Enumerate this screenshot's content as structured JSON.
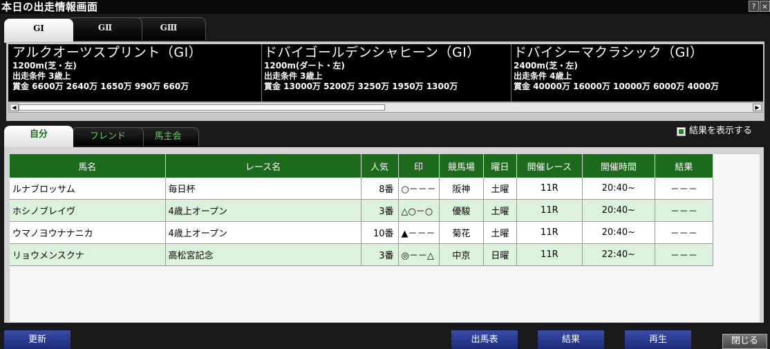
{
  "window": {
    "title": "本日の出走情報画面",
    "help_label": "?",
    "close_label": "×"
  },
  "grade_tabs": [
    {
      "label": "GⅠ",
      "active": true
    },
    {
      "label": "GⅡ",
      "active": false
    },
    {
      "label": "GⅢ",
      "active": false
    }
  ],
  "races": [
    {
      "name": "アルクオーツスプリント（GⅠ）",
      "distance": "1200m(芝・左)",
      "condition": "出走条件 3歳上",
      "prize": "賞金  6600万 2640万 1650万 990万 660万"
    },
    {
      "name": "ドバイゴールデンシャヒーン（GⅠ）",
      "distance": "1200m(ダート・左)",
      "condition": "出走条件 3歳上",
      "prize": "賞金  13000万 5200万 3250万 1950万 1300万"
    },
    {
      "name": "ドバイシーマクラシック（GⅠ）",
      "distance": "2400m(芝・左)",
      "condition": "出走条件 4歳上",
      "prize": "賞金  40000万 16000万 10000万 6000万 4000万"
    }
  ],
  "scroll": {
    "left_arrow": "◀",
    "right_arrow": "▶"
  },
  "friend_tabs": [
    {
      "label": "自分",
      "active": true
    },
    {
      "label": "フレンド",
      "active": false
    },
    {
      "label": "馬主会",
      "active": false
    }
  ],
  "show_results": {
    "label": "結果を表示する",
    "checked": true
  },
  "table": {
    "headers": [
      "馬名",
      "レース名",
      "人気",
      "印",
      "競馬場",
      "曜日",
      "開催レース",
      "開催時間",
      "結果"
    ],
    "rows": [
      [
        "ルナブロッサム",
        "毎日杯",
        "8番",
        "○－－－",
        "阪神",
        "土曜",
        "11R",
        "20:40~",
        "－－－"
      ],
      [
        "ホシノブレイヴ",
        "4歳上オープン",
        "3番",
        "△○－○",
        "優駿",
        "土曜",
        "11R",
        "20:40~",
        "－－－"
      ],
      [
        "ウマノヨウナナニカ",
        "4歳上オープン",
        "10番",
        "▲－－－",
        "菊花",
        "土曜",
        "11R",
        "20:40~",
        "－－－"
      ],
      [
        "リョウメンスクナ",
        "高松宮記念",
        "3番",
        "◎－－△",
        "中京",
        "日曜",
        "11R",
        "22:40~",
        "－－－"
      ]
    ]
  },
  "buttons": {
    "update": "更新",
    "entries": "出馬表",
    "result": "結果",
    "replay": "再生",
    "close": "閉じる"
  },
  "colors": {
    "header_green": "#1c6a1c",
    "row_alt": "#ddf2dd",
    "button_blue": "#2a3a92"
  }
}
